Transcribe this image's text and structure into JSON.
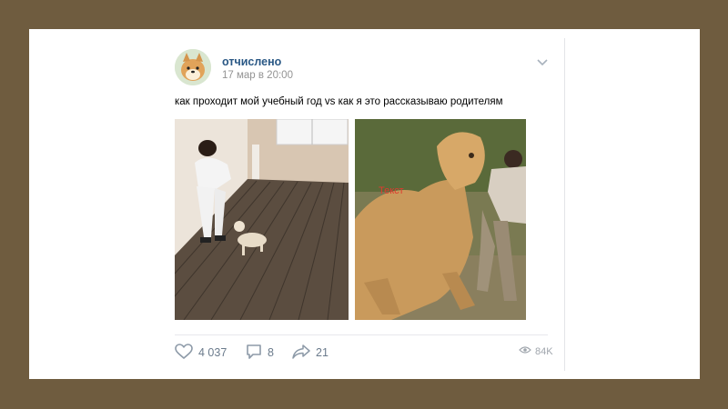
{
  "post": {
    "author": "отчислено",
    "date": "17 мар в 20:00",
    "text": "как проходит мой учебный год vs как я это рассказываю родителям",
    "image_caption": "Текст"
  },
  "actions": {
    "likes": "4 037",
    "comments": "8",
    "shares": "21",
    "views": "84K"
  },
  "icons": {
    "like": "heart-icon",
    "comment": "comment-icon",
    "share": "share-icon",
    "views": "eye-icon",
    "menu": "chevron-down-icon"
  },
  "colors": {
    "background": "#6f5c3f",
    "link": "#2a5885",
    "muted": "#939393",
    "caption": "#e03b2f"
  }
}
